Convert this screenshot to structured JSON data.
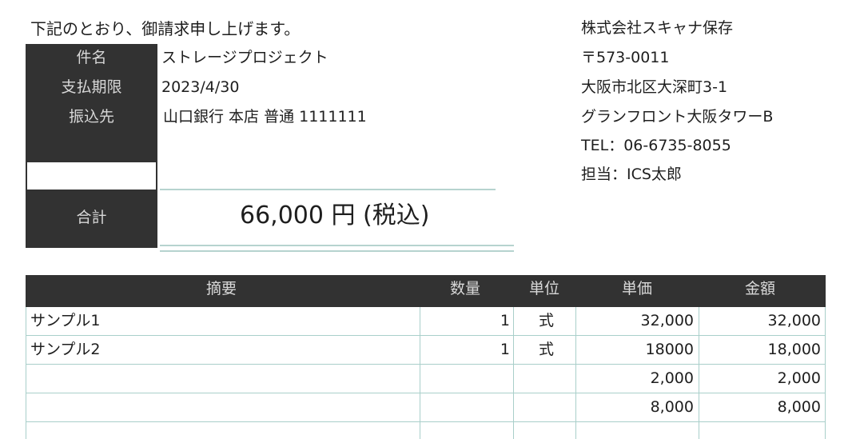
{
  "intro": "下記のとおり、御請求申し上げます。",
  "labels": {
    "subject": "件名",
    "due_date": "支払期限",
    "bank": "振込先",
    "total": "合計"
  },
  "values": {
    "subject": "ストレージプロジェクト",
    "due_date": "2023/4/30",
    "bank": "山口銀行 本店 普通 1111111",
    "total": "66,000 円 (税込)"
  },
  "sender": {
    "company": "株式会社スキャナ保存",
    "postal": "〒573-0011",
    "address1": "大阪市北区大深町3-1",
    "address2": "グランフロント大阪タワーB",
    "tel": "TEL：06-6735-8055",
    "contact": "担当：ICS太郎"
  },
  "table": {
    "headers": [
      "摘要",
      "数量",
      "単位",
      "単価",
      "金額"
    ],
    "rows": [
      {
        "desc": "サンプル1",
        "qty": "1",
        "unit": "式",
        "price": "32,000",
        "amount": "32,000"
      },
      {
        "desc": "サンプル2",
        "qty": "1",
        "unit": "式",
        "price": "18000",
        "amount": "18,000"
      },
      {
        "desc": "",
        "qty": "",
        "unit": "",
        "price": "2,000",
        "amount": "2,000"
      },
      {
        "desc": "",
        "qty": "",
        "unit": "",
        "price": "8,000",
        "amount": "8,000"
      }
    ]
  },
  "colors": {
    "dark_fill": "#323232",
    "grid_teal": "#a9cfca"
  }
}
